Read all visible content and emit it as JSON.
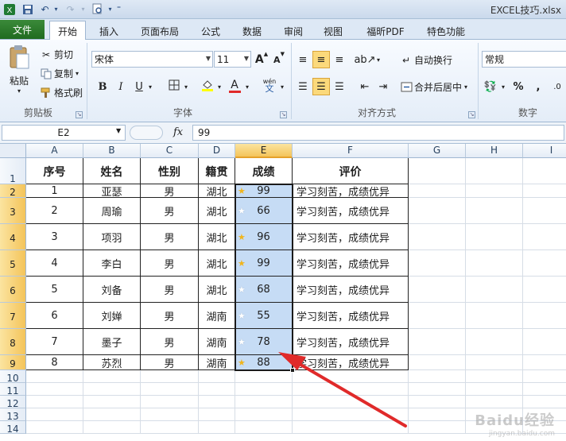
{
  "window": {
    "title": "EXCEL技巧.xlsx"
  },
  "tabs": {
    "file": "文件",
    "items": [
      "开始",
      "插入",
      "页面布局",
      "公式",
      "数据",
      "审阅",
      "视图",
      "福昕PDF",
      "特色功能"
    ]
  },
  "ribbon": {
    "clipboard": {
      "label": "剪贴板",
      "paste": "粘贴",
      "cut": "剪切",
      "copy": "复制",
      "format_painter": "格式刷"
    },
    "font": {
      "label": "字体",
      "font_name": "宋体",
      "font_size": "11",
      "bold": "B",
      "italic": "I",
      "underline": "U",
      "grow": "A",
      "shrink": "A",
      "font_color": "A",
      "wen": "wén",
      "wen_glyph": "文"
    },
    "alignment": {
      "label": "对齐方式",
      "wrap_text": "自动换行",
      "merge_center": "合并后居中"
    },
    "number": {
      "label": "数字",
      "format": "常规",
      "percent": "%",
      "comma": ","
    }
  },
  "formula_bar": {
    "name_box": "E2",
    "fx": "fx",
    "value": "99"
  },
  "sheet": {
    "columns": [
      "A",
      "B",
      "C",
      "D",
      "E",
      "F",
      "G",
      "H",
      "I"
    ],
    "rows": [
      "1",
      "2",
      "3",
      "4",
      "5",
      "6",
      "7",
      "8",
      "9",
      "10",
      "11",
      "12",
      "13",
      "14"
    ],
    "selected_column": "E",
    "headers": [
      "序号",
      "姓名",
      "性别",
      "籍贯",
      "成绩",
      "评价"
    ],
    "records": [
      {
        "no": "1",
        "name": "亚瑟",
        "gender": "男",
        "origin": "湖北",
        "score": "99",
        "star": "gold",
        "comment": "学习刻苦，成绩优异"
      },
      {
        "no": "2",
        "name": "周瑜",
        "gender": "男",
        "origin": "湖北",
        "score": "66",
        "star": "white",
        "comment": "学习刻苦，成绩优异"
      },
      {
        "no": "3",
        "name": "项羽",
        "gender": "男",
        "origin": "湖北",
        "score": "96",
        "star": "gold",
        "comment": "学习刻苦，成绩优异"
      },
      {
        "no": "4",
        "name": "李白",
        "gender": "男",
        "origin": "湖北",
        "score": "99",
        "star": "gold",
        "comment": "学习刻苦，成绩优异"
      },
      {
        "no": "5",
        "name": "刘备",
        "gender": "男",
        "origin": "湖北",
        "score": "68",
        "star": "white",
        "comment": "学习刻苦，成绩优异"
      },
      {
        "no": "6",
        "name": "刘婵",
        "gender": "男",
        "origin": "湖南",
        "score": "55",
        "star": "white",
        "comment": "学习刻苦，成绩优异"
      },
      {
        "no": "7",
        "name": "墨子",
        "gender": "男",
        "origin": "湖南",
        "score": "78",
        "star": "white",
        "comment": "学习刻苦，成绩优异"
      },
      {
        "no": "8",
        "name": "苏烈",
        "gender": "男",
        "origin": "湖南",
        "score": "88",
        "star": "gold",
        "comment": "学习刻苦，成绩优异"
      }
    ]
  },
  "watermark": {
    "brand": "Baidu经验",
    "url": "jingyan.baidu.com"
  },
  "colors": {
    "file_tab": "#2a7a2a",
    "selection_fill": "#c6dcf5",
    "annotation_arrow": "#e02a2a",
    "gold_star": "#f1b51c"
  }
}
